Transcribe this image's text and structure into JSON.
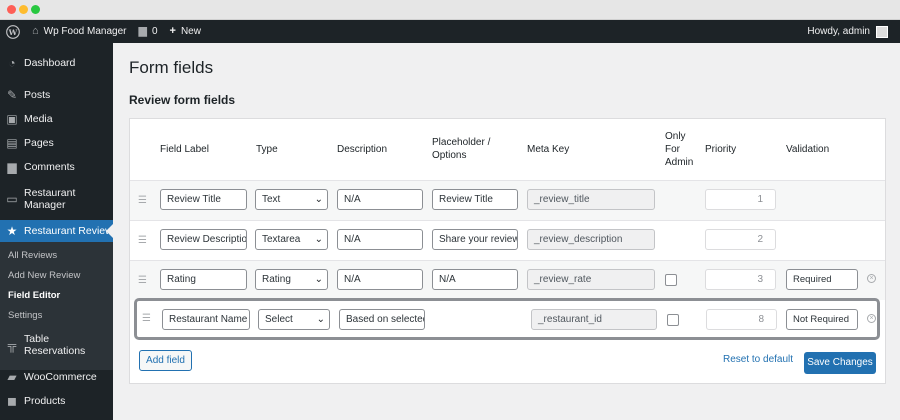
{
  "admin_bar": {
    "site_name": "Wp Food Manager",
    "comments_count": "0",
    "new_label": "New",
    "howdy": "Howdy, admin"
  },
  "sidebar": {
    "items": [
      {
        "label": "Dashboard",
        "icon": "dashboard-icon"
      },
      {
        "label": "Posts",
        "icon": "pin-icon"
      },
      {
        "label": "Media",
        "icon": "media-icon"
      },
      {
        "label": "Pages",
        "icon": "pages-icon"
      },
      {
        "label": "Comments",
        "icon": "comments-icon"
      },
      {
        "label": "Restaurant Manager",
        "icon": "restaurant-icon"
      },
      {
        "label": "Restaurant Review",
        "icon": "star-icon"
      },
      {
        "label": "Table Reservations",
        "icon": "table-icon"
      },
      {
        "label": "WooCommerce",
        "icon": "woocommerce-icon"
      },
      {
        "label": "Products",
        "icon": "products-icon"
      }
    ],
    "submenu": [
      "All Reviews",
      "Add New Review",
      "Field Editor",
      "Settings"
    ]
  },
  "page": {
    "title": "Form fields",
    "section_title": "Review form fields"
  },
  "table": {
    "headers": {
      "field_label": "Field Label",
      "type": "Type",
      "description": "Description",
      "placeholder": "Placeholder / Options",
      "meta_key": "Meta Key",
      "only_for_admin": "Only For Admin",
      "priority": "Priority",
      "validation": "Validation"
    },
    "rows": [
      {
        "label": "Review Title",
        "type": "Text",
        "description": "N/A",
        "placeholder": "Review Title",
        "meta_key": "_review_title",
        "priority": "1",
        "validation": ""
      },
      {
        "label": "Review Description",
        "type": "Textarea",
        "description": "N/A",
        "placeholder": "Share your review",
        "meta_key": "_review_description",
        "priority": "2",
        "validation": ""
      },
      {
        "label": "Rating",
        "type": "Rating",
        "description": "N/A",
        "placeholder": "N/A",
        "meta_key": "_review_rate",
        "priority": "3",
        "validation": "Required"
      },
      {
        "label": "Restaurant Name",
        "type": "Select",
        "description": "Based on selected",
        "placeholder": "",
        "meta_key": "_restaurant_id",
        "priority": "8",
        "validation": "Not Required"
      }
    ]
  },
  "actions": {
    "add_field": "Add field",
    "reset": "Reset to default",
    "save": "Save Changes"
  },
  "colors": {
    "accent": "#2271b1",
    "admin_bar": "#1d2327",
    "submenu_bg": "#2c3338"
  }
}
